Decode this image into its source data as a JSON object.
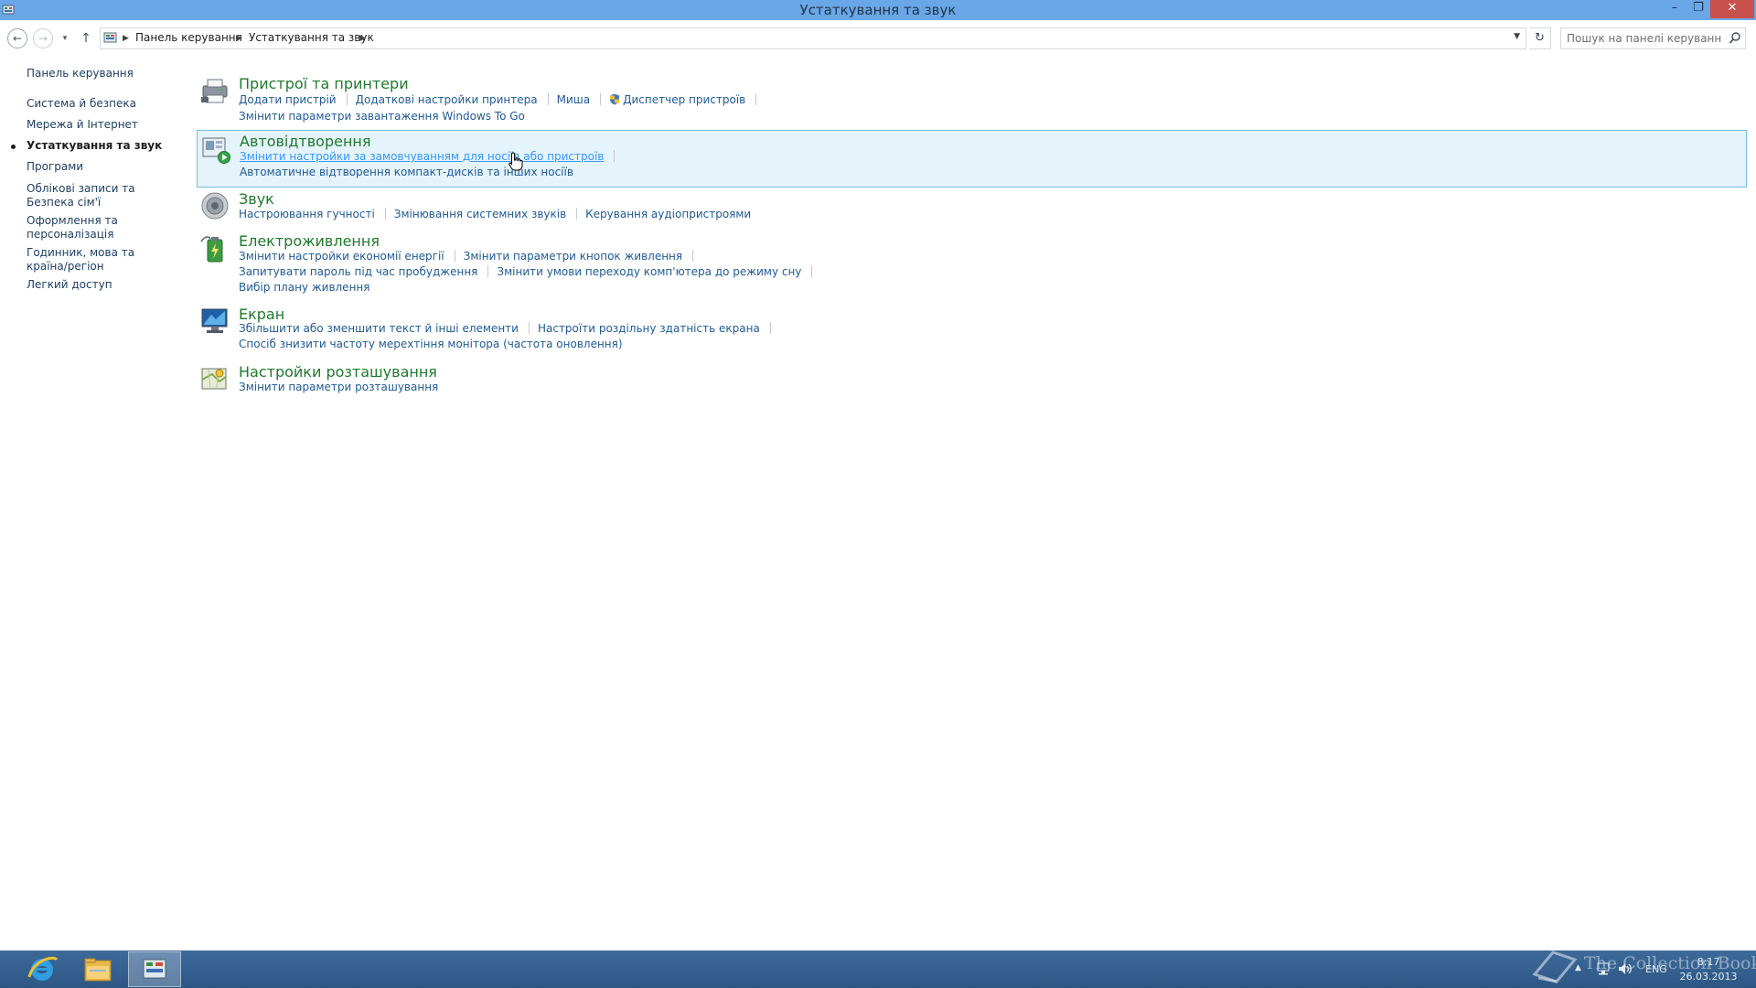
{
  "window": {
    "title": "Устаткування та звук",
    "minimize": "–",
    "maximize": "❐",
    "close": "✕"
  },
  "addressbar": {
    "breadcrumbs": [
      "Панель керування",
      "Устаткування та звук"
    ],
    "search_placeholder": "Пошук на панелі керування",
    "back": "←",
    "forward": "→",
    "recent": "▾",
    "up": "↑",
    "refresh": "↻"
  },
  "sidebar": {
    "items": [
      {
        "label": "Панель керування"
      },
      {
        "label": "Система й безпека"
      },
      {
        "label": "Мережа й Інтернет"
      },
      {
        "label": "Устаткування та звук",
        "current": true
      },
      {
        "label": "Програми"
      },
      {
        "label": "Облікові записи та Безпека сім'ї"
      },
      {
        "label": "Оформлення та персоналізація"
      },
      {
        "label": "Годинник, мова та країна/регіон"
      },
      {
        "label": "Легкий доступ"
      }
    ]
  },
  "categories": [
    {
      "title": "Пристрої та принтери",
      "icon": "printer-icon",
      "rows": [
        [
          "Додати пристрій",
          "Додаткові настройки принтера",
          "Миша",
          "Диспетчер пристроїв"
        ],
        [
          "Змінити параметри завантаження Windows To Go"
        ]
      ]
    },
    {
      "title": "Автовідтворення",
      "icon": "autoplay-icon",
      "rows": [
        [
          "Змінити настройки за замовчуванням для носіїв або пристроїв"
        ],
        [
          "Автоматичне відтворення компакт-дисків та інших носіїв"
        ]
      ]
    },
    {
      "title": "Звук",
      "icon": "speaker-icon",
      "rows": [
        [
          "Настроювання гучності",
          "Змінювання системних звуків",
          "Керування аудіопристроями"
        ]
      ]
    },
    {
      "title": "Електроживлення",
      "icon": "battery-icon",
      "rows": [
        [
          "Змінити настройки економії енергії",
          "Змінити параметри кнопок живлення"
        ],
        [
          "Запитувати пароль під час пробудження",
          "Змінити умови переходу комп'ютера до режиму сну"
        ],
        [
          "Вибір плану живлення"
        ]
      ]
    },
    {
      "title": "Екран",
      "icon": "monitor-icon",
      "rows": [
        [
          "Збільшити або зменшити текст й інші елементи",
          "Настроїти роздільну здатність екрана"
        ],
        [
          "Спосіб знизити частоту мерехтіння монітора (частота оновлення)"
        ]
      ]
    },
    {
      "title": "Настройки розташування",
      "icon": "location-icon",
      "rows": [
        [
          "Змінити параметри розташування"
        ]
      ]
    }
  ],
  "taskbar": {
    "language": "ENG",
    "time": "8:17",
    "date": "26.03.2013",
    "tray_arrow": "▲"
  },
  "watermark": "The Collection Book",
  "colors": {
    "titlebar": "#6aa7e8",
    "category_title": "#1e7a2c",
    "link": "#1e5a96",
    "highlight_bg": "#e5f3fb",
    "highlight_border": "#70c0e7",
    "taskbar": "#2d5684"
  }
}
